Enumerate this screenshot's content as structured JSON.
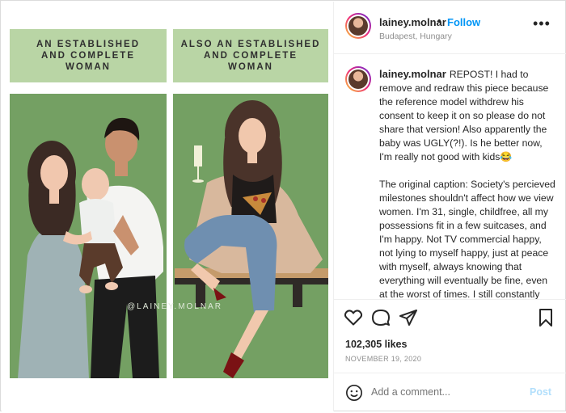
{
  "media": {
    "left_heading": "AN ESTABLISHED\nAND COMPLETE\nWOMAN",
    "right_heading": "ALSO AN ESTABLISHED\nAND COMPLETE\nWOMAN",
    "watermark": "@LAINEY.MOLNAR"
  },
  "header": {
    "username": "lainey.molnar",
    "dot": "•",
    "follow": "Follow",
    "location": "Budapest, Hungary",
    "more": "•••"
  },
  "caption": {
    "username": "lainey.molnar",
    "paragraph1": "REPOST! I had to remove and redraw this piece because the reference model withdrew his consent to keep it on so please do not share that version! Also apparently the baby was UGLY(?!). Is he better now, I'm really not good with kids😂",
    "paragraph2": "The original caption: Society's percieved milestones shouldn't affect how we view women. I'm 31, single, childfree, all my possessions fit in a few suitcases, and I'm happy. Not TV commercial happy, not lying to myself happy, just at peace with myself, always knowing that everything will eventually be fine, even at the worst of times. I still constantly hear \"I hope you find a partner soon\", \"You'll meet him when you least expect it\". \"Maybe"
  },
  "actions": {
    "likes": "102,305 likes",
    "date": "NOVEMBER 19, 2020"
  },
  "comment": {
    "placeholder": "Add a comment...",
    "post": "Post"
  },
  "colors": {
    "panel_green": "#74a063",
    "heading_green": "#b9d5a5",
    "link_blue": "#0095f6"
  }
}
